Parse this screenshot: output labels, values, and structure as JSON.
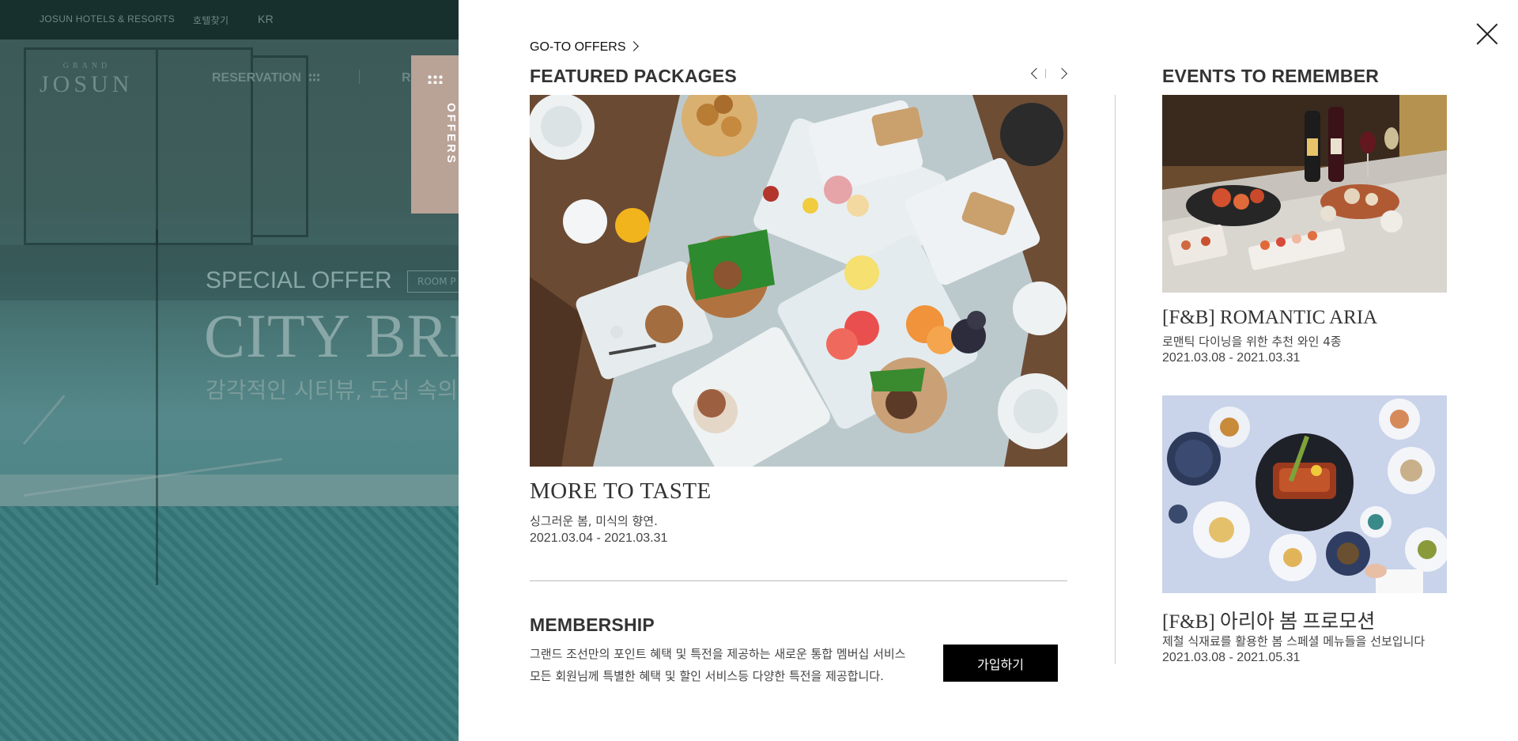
{
  "background_site": {
    "brand": "JOSUN HOTELS & RESORTS",
    "hotel_finder": "호텔찾기",
    "language": "KR",
    "logo_small": "GRAND",
    "logo": "JOSUN",
    "reservation": "RESERVATION",
    "nav_partial": "R",
    "special_offer": "SPECIAL OFFER",
    "room_button": "ROOM P",
    "headline": "CITY BREA",
    "subheadline": "감각적인 시티뷰, 도심 속의"
  },
  "close_offers": {
    "label": "CLOSE OFFERS"
  },
  "offers_panel": {
    "goto_offers": "GO-TO OFFERS",
    "featured": {
      "title": "FEATURED PACKAGES",
      "package": {
        "title": "MORE TO TASTE",
        "description": "싱그러운 봄, 미식의 향연.",
        "date": "2021.03.04 - 2021.03.31"
      }
    },
    "membership": {
      "title": "MEMBERSHIP",
      "line1": "그랜드 조선만의 포인트 혜택 및 특전을 제공하는 새로운 통합 멤버십 서비스",
      "line2": "모든 회원님께 특별한 혜택 및 할인 서비스등 다양한 특전을 제공합니다.",
      "join_label": "가입하기"
    },
    "events": {
      "title": "EVENTS TO REMEMBER",
      "items": [
        {
          "title": "[F&B] ROMANTIC ARIA",
          "description": "로맨틱 다이닝을 위한 추천 와인 4종",
          "date": "2021.03.08 - 2021.03.31"
        },
        {
          "title": "[F&B] 아리아 봄 프로모션",
          "description": "제철 식재료를 활용한 봄 스페셜 메뉴들을 선보입니다",
          "date": "2021.03.08 - 2021.05.31"
        }
      ]
    }
  }
}
